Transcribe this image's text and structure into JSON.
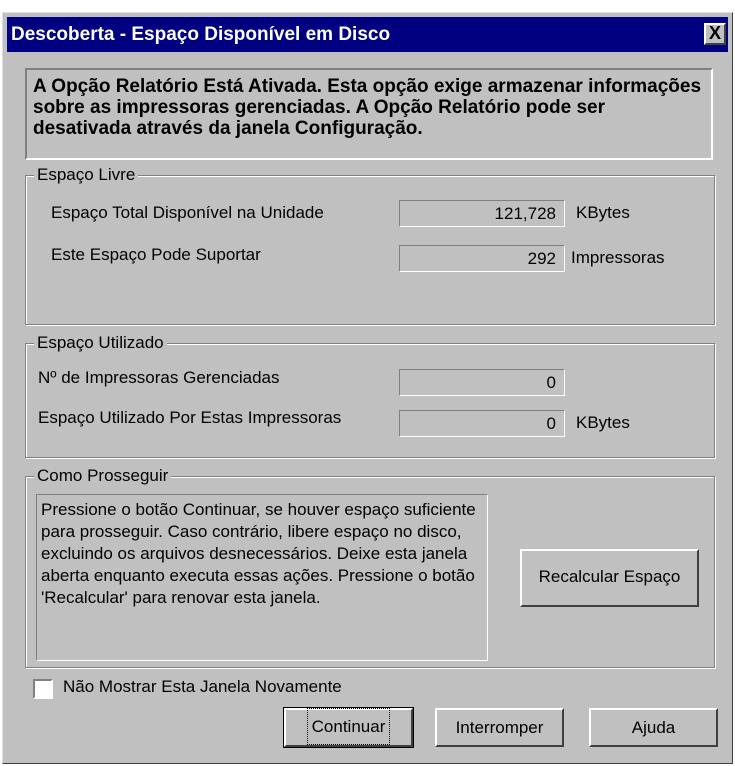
{
  "window": {
    "title": "Descoberta - Espaço Disponível em Disco",
    "close_label": "X"
  },
  "info_message": "A Opção Relatório Está Ativada. Esta opção exige armazenar informações sobre as impressoras gerenciadas. A Opção Relatório pode ser desativada através da janela Configuração.",
  "espaco_livre": {
    "legend": "Espaço Livre",
    "total_label": "Espaço Total Disponível na Unidade",
    "total_value": "121,728",
    "total_unit": "KBytes",
    "support_label": "Este Espaço Pode Suportar",
    "support_value": "292",
    "support_unit": "Impressoras"
  },
  "espaco_utilizado": {
    "legend": "Espaço Utilizado",
    "managed_label": "Nº de Impressoras Gerenciadas",
    "managed_value": "0",
    "used_label": "Espaço Utilizado Por Estas Impressoras",
    "used_value": "0",
    "used_unit": "KBytes"
  },
  "como_prosseguir": {
    "legend": "Como Prosseguir",
    "text": "Pressione o botão Continuar, se houver espaço suficiente para prosseguir. Caso contrário, libere espaço no disco, excluindo os arquivos desnecessários. Deixe esta janela aberta enquanto executa essas ações. Pressione o botão 'Recalcular' para renovar esta janela.",
    "recalc_label": "Recalcular Espaço"
  },
  "checkbox": {
    "label": "Não Mostrar Esta Janela Novamente",
    "checked": false
  },
  "buttons": {
    "continue": "Continuar",
    "abort": "Interromper",
    "help": "Ajuda"
  }
}
